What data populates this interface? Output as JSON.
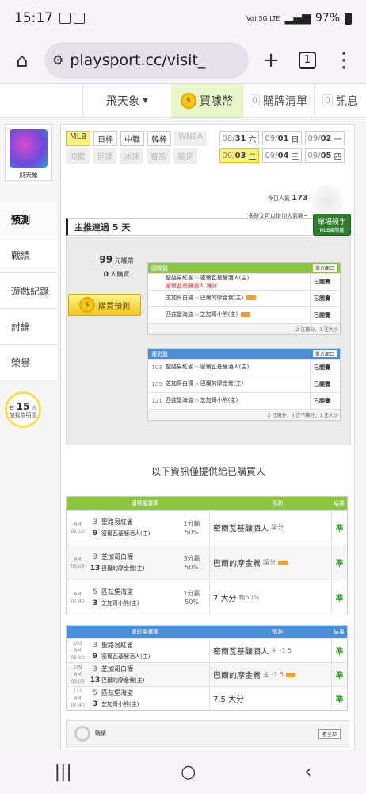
{
  "status": {
    "time": "15:17",
    "network": "Vo) 5G LTE",
    "battery": "97%"
  },
  "browser": {
    "url": "playsport.cc/visit_",
    "tab_count": "1"
  },
  "topnav": {
    "user": "飛天象",
    "buy": "買噱幣",
    "cart_count": "0",
    "cart": "購牌清單",
    "msg_count": "0",
    "msg": "訊息"
  },
  "sidebar": {
    "avatar_name": "飛天象",
    "items": [
      "預測",
      "戰績",
      "遊戲紀錄",
      "討論",
      "榮譽"
    ],
    "bulb": {
      "pre": "有",
      "count": "15",
      "unit": "人",
      "line2": "加我為明燈"
    }
  },
  "sports": [
    {
      "label": "MLB",
      "state": "on"
    },
    {
      "label": "日棒",
      "state": ""
    },
    {
      "label": "中職",
      "state": ""
    },
    {
      "label": "韓棒",
      "state": ""
    },
    {
      "label": "WNBA",
      "state": "dis"
    },
    {
      "label": "澳籃",
      "state": "dis"
    },
    {
      "label": "足球",
      "state": "dis"
    },
    {
      "label": "冰球",
      "state": "dis"
    },
    {
      "label": "賽馬",
      "state": "dis"
    },
    {
      "label": "美足",
      "state": "dis"
    }
  ],
  "dates": [
    {
      "md": "08/",
      "d": "31",
      "w": "六",
      "sel": false
    },
    {
      "md": "09/",
      "d": "01",
      "w": "日",
      "sel": false
    },
    {
      "md": "09/",
      "d": "02",
      "w": "一",
      "sel": false
    },
    {
      "md": "09/",
      "d": "03",
      "w": "二",
      "sel": true
    },
    {
      "md": "09/",
      "d": "04",
      "w": "三",
      "sel": false
    },
    {
      "md": "09/",
      "d": "05",
      "w": "四",
      "sel": false
    }
  ],
  "popularity": {
    "label": "今日人氣",
    "value": "173",
    "note": "多發文可以增加人氣喔~"
  },
  "streak": "主推連過 5 天",
  "killer_badge": {
    "line1": "單場殺手",
    "line2": "MLB國際盤"
  },
  "predict": {
    "price": "99",
    "price_unit": "元噱幣",
    "buyers": "0",
    "buyers_unit": "人購買",
    "buy_button": "購買預測",
    "intl": {
      "header": "國際盤",
      "tag": "單介面口",
      "foot": "2 注讓分，1 注大小",
      "rows": [
        {
          "a": "聖路易紅雀",
          "b": "密爾瓦基釀酒人(主)",
          "pick": "密爾瓦基釀酒人  讓分",
          "result": "已開賽"
        },
        {
          "a": "芝加哥白襪",
          "b": "巴爾的摩金鶯(主)",
          "pick": "",
          "result": "已開賽"
        },
        {
          "a": "匹茲堡海盜",
          "b": "芝加哥小熊(主)",
          "pick": "",
          "result": "已開賽"
        }
      ]
    },
    "lottery": {
      "header": "運彩盤",
      "tag": "單介面口",
      "foot": "2 注讓分，0 注不讓分，1 注大小",
      "rows": [
        {
          "no": "103",
          "a": "聖路易紅雀",
          "b": "密爾瓦基釀酒人(主)",
          "result": "已開賽"
        },
        {
          "no": "109",
          "a": "芝加哥白襪",
          "b": "巴爾的摩金鶯(主)",
          "result": "已開賽"
        },
        {
          "no": "121",
          "a": "匹茲堡海盜",
          "b": "芝加哥小熊(主)",
          "result": "已開賽"
        }
      ]
    }
  },
  "info_title": "以下資訊僅提供給已購買人",
  "intl_results": {
    "header": {
      "match": "國際盤賽事",
      "pick": "預測",
      "result": "結果"
    },
    "rows": [
      {
        "time": "AM 02:10",
        "sa": "3",
        "sb": "9",
        "ta": "聖路易紅雀",
        "tb": "密爾瓦基釀酒人(主)",
        "line": "1分輸",
        "pct": "50%",
        "pick": "密爾瓦基釀酒人",
        "pick_type": "讓分",
        "res": "準"
      },
      {
        "time": "AM 03:05",
        "sa": "3",
        "sb": "13",
        "ta": "芝加哥白襪",
        "tb": "巴爾的摩金鶯(主)",
        "line": "3分贏",
        "pct": "50%",
        "pick": "巴爾的摩金鶯",
        "pick_type": "讓分",
        "res": "準"
      },
      {
        "time": "AM 07:40",
        "sa": "5",
        "sb": "3",
        "ta": "匹茲堡海盜",
        "tb": "芝加哥小熊(主)",
        "line": "1分贏",
        "pct": "50%",
        "pick": "7 大分",
        "pick_type": "輸50%",
        "res": "準"
      }
    ]
  },
  "lottery_results": {
    "header": {
      "match": "運彩盤賽事",
      "pick": "預測",
      "result": "結果"
    },
    "rows": [
      {
        "no": "103",
        "time": "AM 02:10",
        "sa": "3",
        "sb": "9",
        "ta": "聖路易紅雀",
        "tb": "密爾瓦基釀酒人(主)",
        "pick": "密爾瓦基釀酒人",
        "pick_type": "主 -1.5",
        "res": "準"
      },
      {
        "no": "109",
        "time": "AM 03:05",
        "sa": "3",
        "sb": "13",
        "ta": "芝加哥白襪",
        "tb": "巴爾的摩金鶯(主)",
        "pick": "巴爾的摩金鶯",
        "pick_type": "主 -1.5",
        "res": "準"
      },
      {
        "no": "121",
        "time": "AM 07:40",
        "sa": "5",
        "sb": "3",
        "ta": "匹茲堡海盜",
        "tb": "芝加哥小熊(主)",
        "pick": "7.5 大分",
        "pick_type": "",
        "res": "準"
      }
    ]
  },
  "record": {
    "label": "戰績",
    "all": "看全部"
  },
  "colors": {
    "green_header": "#8cc63f",
    "blue_header": "#4a8fd8",
    "highlight": "#fff27a"
  }
}
